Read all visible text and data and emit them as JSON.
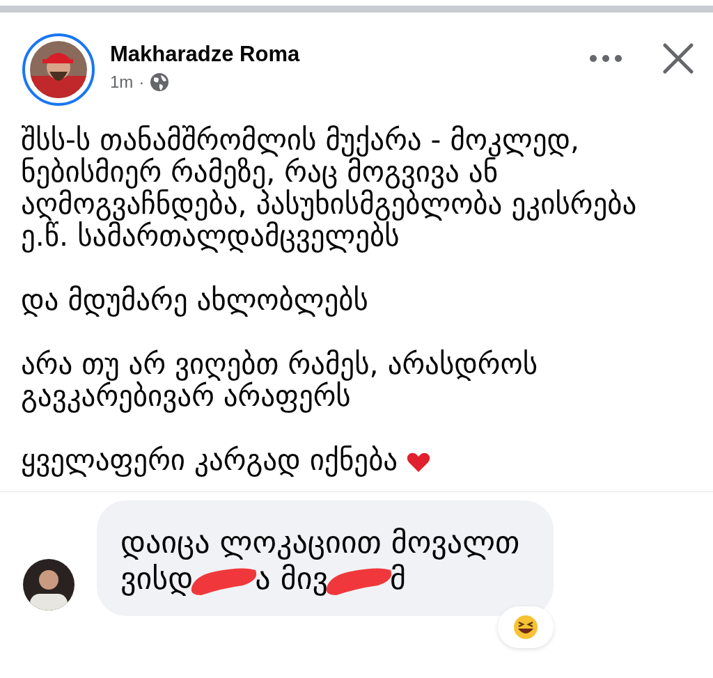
{
  "post": {
    "author": "Makharadze Roma",
    "time": "1m",
    "separator": "·",
    "paragraphs": [
      {
        "text": "შსს-ს თანამშრომლის მუქარა - მოკლედ, ნებისმიერ რამეზე, რაც მოგვივა ან აღმოგვაჩნდება, პასუხისმგებლობა ეკისრება ე.წ. სამართალდამცველებს"
      },
      {
        "text": "და მდუმარე ახლობლებს"
      },
      {
        "text": "არა თუ არ ვიღებთ რამეს, არასდროს გავკარებივარ არაფერს"
      },
      {
        "text": "ყველაფერი კარგად იქნება",
        "heart": true
      }
    ]
  },
  "comment": {
    "line_1": "დაიცა ლოკაციით მოვალთ",
    "line_2": [
      {
        "kind": "text",
        "text": "ვისდ"
      },
      {
        "kind": "redaction"
      },
      {
        "kind": "text",
        "text": "ა მივ"
      },
      {
        "kind": "redaction"
      },
      {
        "kind": "text",
        "text": "მ"
      }
    ],
    "reaction": true
  }
}
